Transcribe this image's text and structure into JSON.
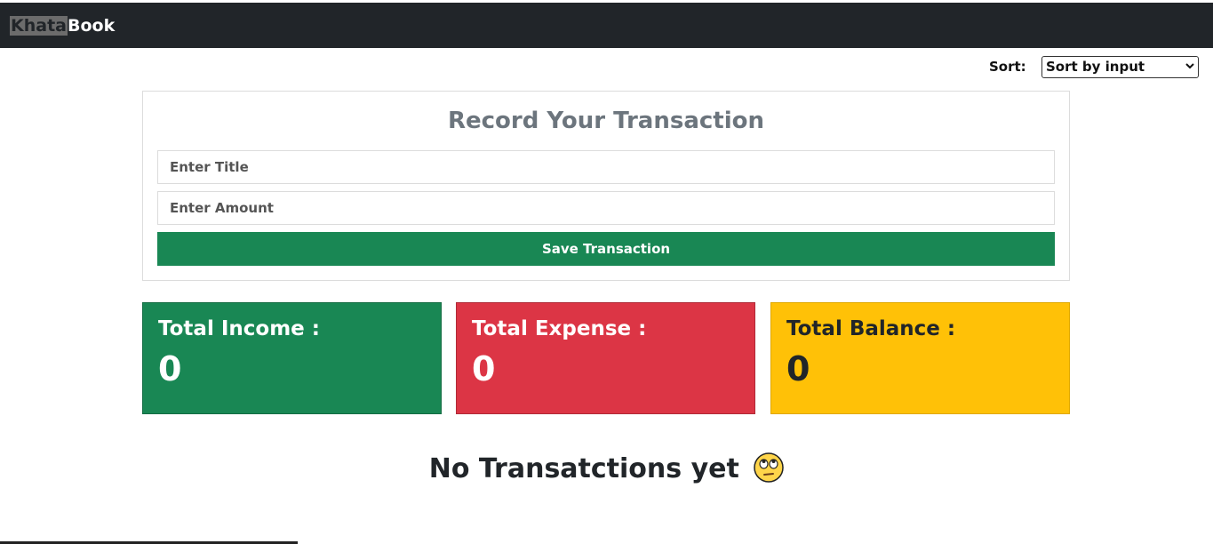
{
  "navbar": {
    "brand_highlight": "Khata",
    "brand_rest": "Book"
  },
  "sort": {
    "label": "Sort:",
    "selected": "Sort by input",
    "icon": "chevron-down-icon"
  },
  "form": {
    "title": "Record Your Transaction",
    "title_placeholder": "Enter Title",
    "amount_placeholder": "Enter Amount",
    "save_label": "Save Transaction"
  },
  "stats": {
    "income": {
      "label": "Total Income :",
      "value": "0",
      "color": "#198754"
    },
    "expense": {
      "label": "Total Expense :",
      "value": "0",
      "color": "#dc3545"
    },
    "balance": {
      "label": "Total Balance :",
      "value": "0",
      "color": "#ffc107"
    }
  },
  "empty_state": {
    "text": "No Transatctions yet",
    "icon": "face-with-rolling-eyes-icon"
  }
}
